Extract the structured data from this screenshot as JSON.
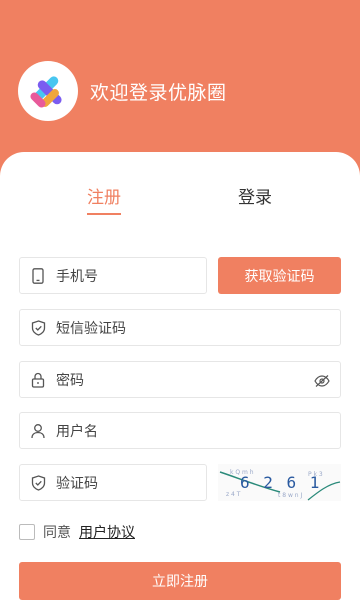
{
  "header": {
    "welcome_text": "欢迎登录优脉圈"
  },
  "tabs": [
    {
      "label": "注册",
      "active": true
    },
    {
      "label": "登录",
      "active": false
    }
  ],
  "form": {
    "phone_placeholder": "手机号",
    "get_code_label": "获取验证码",
    "sms_code_placeholder": "短信验证码",
    "password_placeholder": "密码",
    "username_placeholder": "用户名",
    "captcha_placeholder": "验证码",
    "captcha_text": "6 2 6 1"
  },
  "agreement": {
    "prefix": "同意",
    "link": "用户协议",
    "checked": false
  },
  "submit_label": "立即注册",
  "colors": {
    "accent": "#f08061",
    "background": "#ffffff",
    "border": "#e6e6e6"
  }
}
